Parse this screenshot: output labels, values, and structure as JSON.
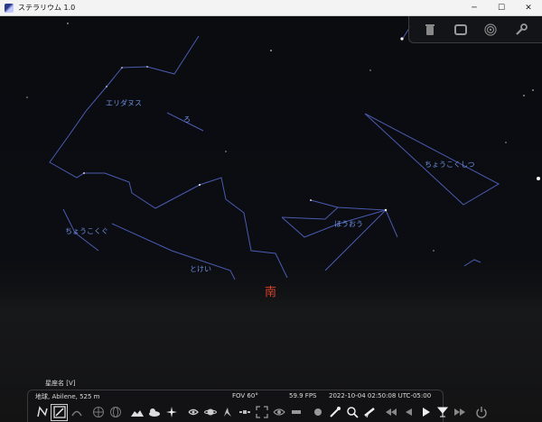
{
  "window": {
    "title": "ステラリウム 1.0",
    "minimize_glyph": "─",
    "maximize_glyph": "☐",
    "close_glyph": "✕"
  },
  "sky": {
    "constellation_labels": [
      {
        "id": "eridanus",
        "text": "エリダヌス"
      },
      {
        "id": "lo",
        "text": "ろ"
      },
      {
        "id": "sculptor",
        "text": "ちょうこくしつ"
      },
      {
        "id": "caelum",
        "text": "ちょうこくぐ"
      },
      {
        "id": "phoenix",
        "text": "ほうおう"
      },
      {
        "id": "horologium",
        "text": "とけい"
      }
    ],
    "cardinal": "南"
  },
  "top_panel": {
    "icons": [
      "trash-icon",
      "window-icon",
      "target-icon",
      "wrench-icon"
    ]
  },
  "bottom": {
    "constellation_names_label": "星座名 [V]",
    "location": "地球, Abilene, 525 m",
    "fov": "FOV 60°",
    "fps": "59.9 FPS",
    "datetime": "2022-10-04 02:50:08 UTC-05:00"
  },
  "colors": {
    "constellation_line": "#4b5bb0",
    "label": "#6d8fe0",
    "cardinal": "#d9432b"
  }
}
